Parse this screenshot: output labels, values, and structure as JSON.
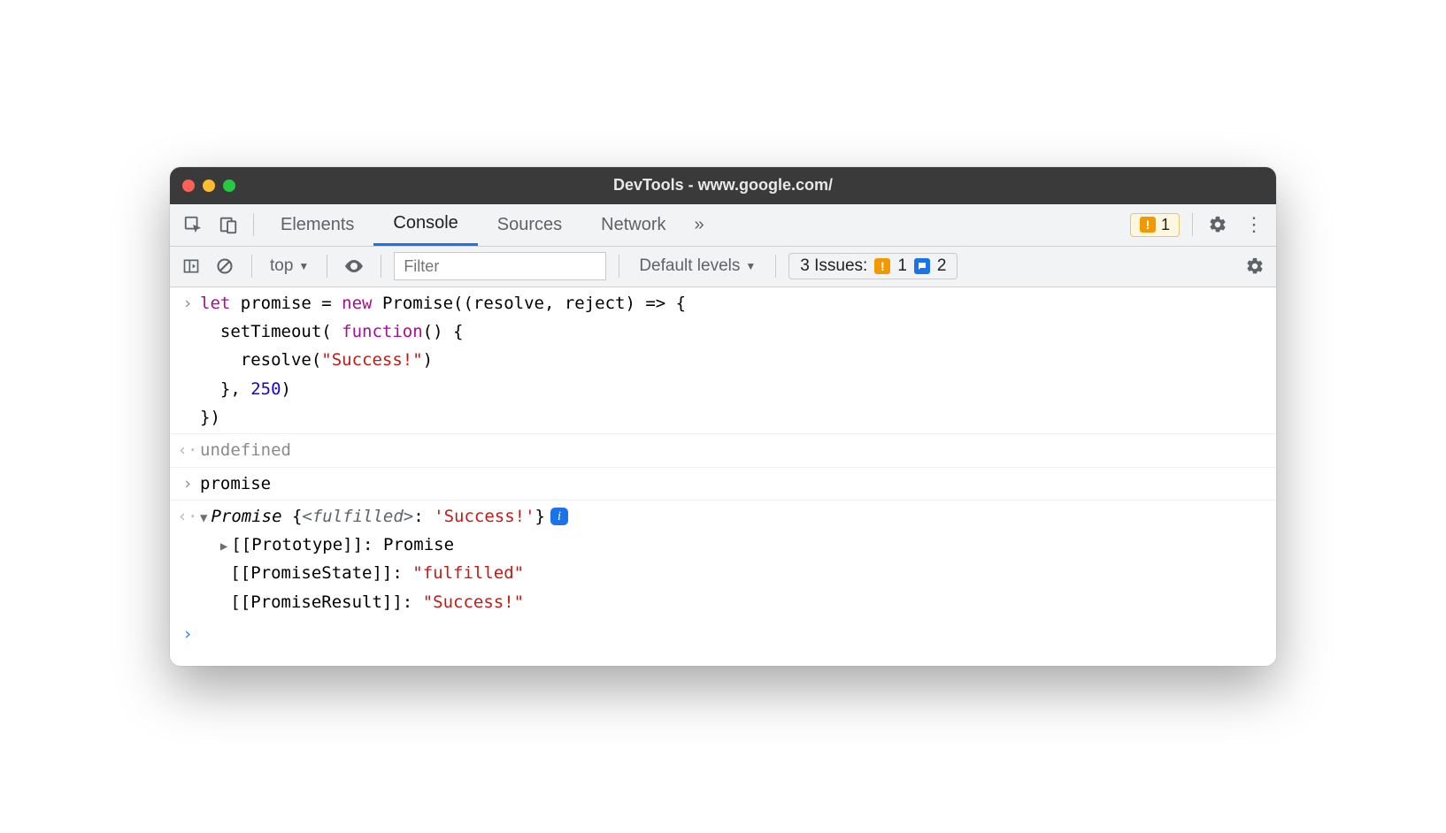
{
  "window": {
    "title": "DevTools - www.google.com/"
  },
  "tabs": {
    "elements": "Elements",
    "console": "Console",
    "sources": "Sources",
    "network": "Network",
    "overflow": "»"
  },
  "tabbar": {
    "warn_count": "1"
  },
  "toolbar": {
    "context": "top",
    "filter_placeholder": "Filter",
    "levels": "Default levels",
    "issues_label": "3 Issues:",
    "issues_warn": "1",
    "issues_info": "2"
  },
  "log": {
    "input1": {
      "l1a": "let",
      "l1b": " promise = ",
      "l1c": "new",
      "l1d": " Promise((resolve, reject) => {",
      "l2a": "  setTimeout( ",
      "l2b": "function",
      "l2c": "() {",
      "l3a": "    resolve(",
      "l3b": "\"Success!\"",
      "l3c": ")",
      "l4a": "  }, ",
      "l4b": "250",
      "l4c": ")",
      "l5": "})"
    },
    "out1": "undefined",
    "input2": "promise",
    "out2": {
      "head_a": "Promise ",
      "head_b": "{",
      "head_c": "<fulfilled>",
      "head_d": ": ",
      "head_e": "'Success!'",
      "head_f": "}",
      "proto_k": "[[Prototype]]",
      "proto_c": ": ",
      "proto_v": "Promise",
      "state_k": "[[PromiseState]]",
      "state_c": ": ",
      "state_v": "\"fulfilled\"",
      "result_k": "[[PromiseResult]]",
      "result_c": ": ",
      "result_v": "\"Success!\""
    }
  }
}
